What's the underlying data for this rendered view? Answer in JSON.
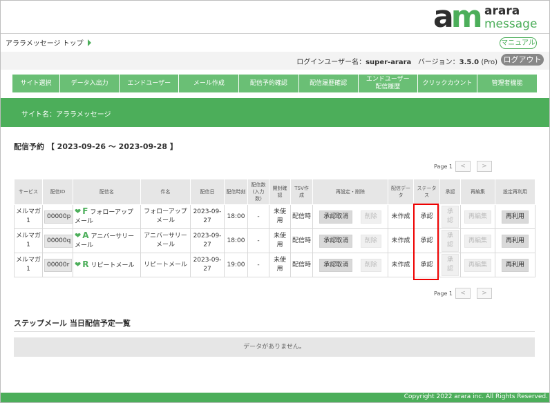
{
  "logo": {
    "mark": "am",
    "line1": "arara",
    "line2": "message"
  },
  "breadcrumb": {
    "label": "アララメッセージ トップ"
  },
  "manual_button": "マニュアル",
  "user": {
    "login_label": "ログインユーザー名：",
    "login_name": "super-arara",
    "version_label": "バージョン：",
    "version": "3.5.0",
    "edition": "(Pro)"
  },
  "logout_button": "ログアウト",
  "nav": [
    "サイト選択",
    "データ入出力",
    "エンドユーザー",
    "メール作成",
    "配信予約確認",
    "配信履歴確認",
    "エンドユーザー配信履歴",
    "クリックカウント",
    "管理者機能"
  ],
  "site_name": "サイト名：アララメッセージ",
  "reservation": {
    "title": "配信予約 【 2023-09-26 〜 2023-09-28 】"
  },
  "pager": {
    "page": "Page 1",
    "prev": "<",
    "next": ">"
  },
  "table": {
    "headers": [
      "サービス",
      "配信ID",
      "配信名",
      "件名",
      "配信日",
      "配信時刻",
      "配信数(入力数)",
      "開封確認",
      "TSV作成",
      "再設定・削除",
      "配信データ",
      "ステータス",
      "承認",
      "再編集",
      "設定再利用"
    ],
    "rows": [
      {
        "service": "メルマガ1",
        "id": "00000p",
        "letter": "F",
        "name": "フォローアップメール",
        "subject": "フォローアップメール",
        "date": "2023-09-27",
        "time": "18:00",
        "count": "-",
        "open": "未使用",
        "tsv": "配信時",
        "cancel": "承認取消",
        "delete": "削除",
        "data": "未作成",
        "status": "承認",
        "approve": "承認",
        "reedit": "再編集",
        "reuse": "再利用"
      },
      {
        "service": "メルマガ1",
        "id": "00000q",
        "letter": "A",
        "name": "アニバーサリーメール",
        "subject": "アニバーサリーメール",
        "date": "2023-09-27",
        "time": "18:00",
        "count": "-",
        "open": "未使用",
        "tsv": "配信時",
        "cancel": "承認取消",
        "delete": "削除",
        "data": "未作成",
        "status": "承認",
        "approve": "承認",
        "reedit": "再編集",
        "reuse": "再利用"
      },
      {
        "service": "メルマガ1",
        "id": "00000r",
        "letter": "R",
        "name": "リピートメール",
        "subject": "リピートメール",
        "date": "2023-09-27",
        "time": "19:00",
        "count": "-",
        "open": "未使用",
        "tsv": "配信時",
        "cancel": "承認取消",
        "delete": "削除",
        "data": "未作成",
        "status": "承認",
        "approve": "承認",
        "reedit": "再編集",
        "reuse": "再利用"
      }
    ]
  },
  "step": {
    "title": "ステップメール 当日配信予定一覧",
    "empty": "データがありません。"
  },
  "footer": "Copyright 2022 arara inc. All Rights Reserved.",
  "colors": {
    "brand_green": "#4cae5a",
    "nav_green": "#6abf75",
    "highlight_red": "#e00000"
  }
}
